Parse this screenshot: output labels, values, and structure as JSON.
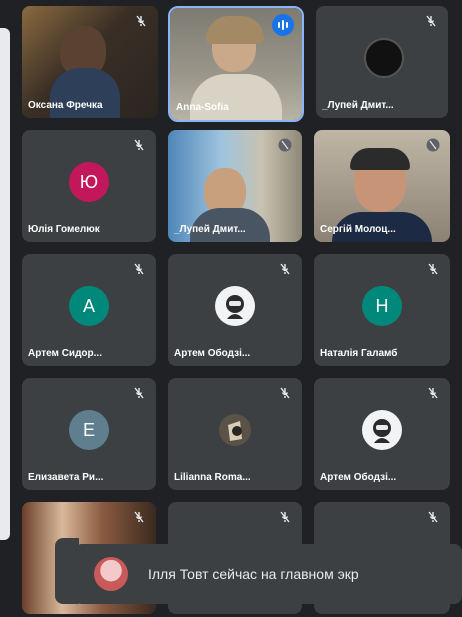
{
  "participants": [
    {
      "name": "Оксана Фречка"
    },
    {
      "name": "Anna-Sofia"
    },
    {
      "name": "_Лупей Дмит..."
    },
    {
      "name": "Юлія Гомелюк",
      "initial": "Ю",
      "color": "#c2185b"
    },
    {
      "name": "_Лупей Дмит..."
    },
    {
      "name": "Сергій Молоц..."
    },
    {
      "name": "Артем Сидор...",
      "initial": "А",
      "color": "#00897b"
    },
    {
      "name": "Артем Ободзі..."
    },
    {
      "name": "Наталія Галамб",
      "initial": "Н",
      "color": "#00897b"
    },
    {
      "name": "Елизавета Ри...",
      "initial": "Е",
      "color": "#5f7f8f"
    },
    {
      "name": "Lilianna Roma..."
    },
    {
      "name": "Артем Ободзі..."
    }
  ],
  "toast": {
    "message": "Ілля Товт сейчас на главном экр"
  }
}
